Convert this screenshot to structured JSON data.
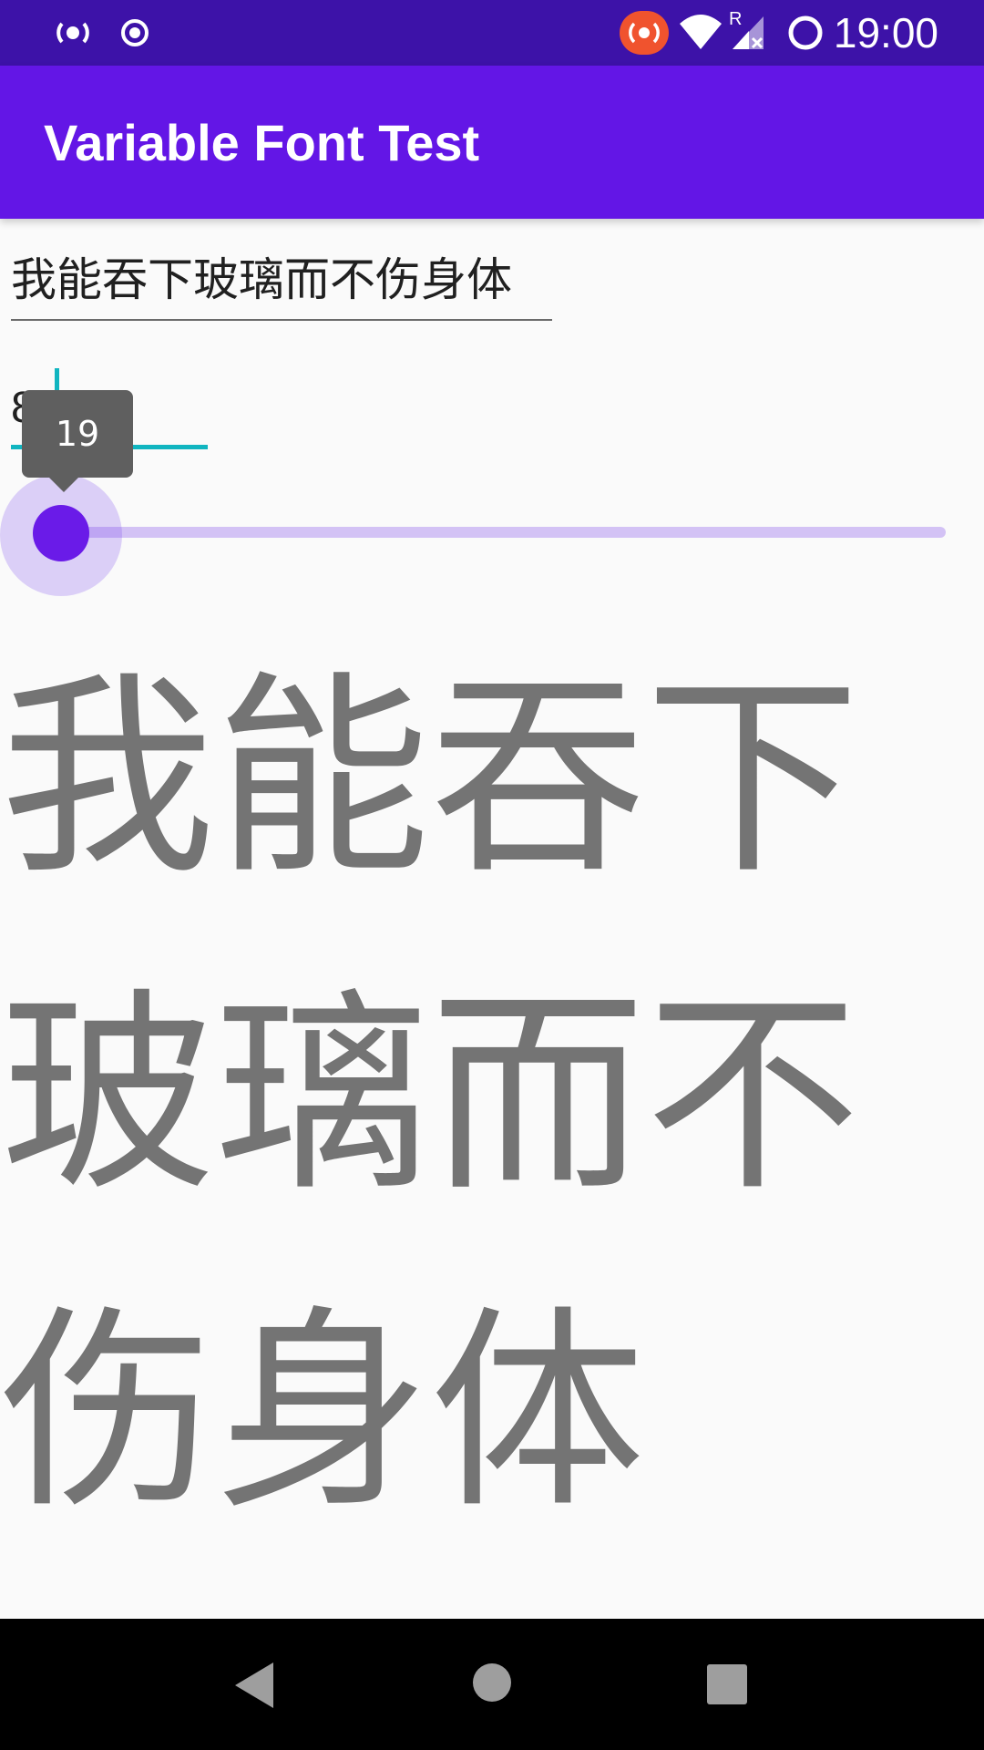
{
  "status_bar": {
    "time": "19:00",
    "icons": [
      "radio-icon",
      "target-icon",
      "cast-icon",
      "wifi-icon",
      "signal-icon",
      "battery-icon"
    ],
    "roaming_label": "R",
    "background": "#3d12a8"
  },
  "app_bar": {
    "title": "Variable Font Test",
    "background": "#6316e6"
  },
  "text_input": {
    "value": "我能吞下玻璃而不伤身体"
  },
  "weight_input": {
    "value": "80"
  },
  "slider": {
    "value": 19,
    "min": 0,
    "max": 1000,
    "tooltip": "19",
    "accent_color": "#6a1be8",
    "track_color": "#d3c2f5"
  },
  "preview": {
    "text": "我能吞下玻璃而不伤身体",
    "color": "#747474"
  },
  "nav_bar": {
    "buttons": [
      "back-icon",
      "home-icon",
      "recents-icon"
    ]
  }
}
